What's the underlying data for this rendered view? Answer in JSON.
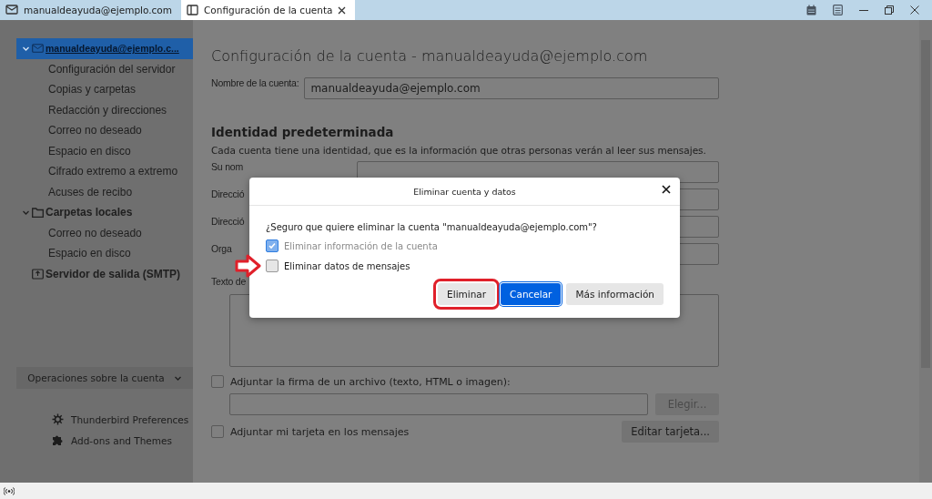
{
  "tabs": [
    {
      "label": "manualdeayuda@ejemplo.com",
      "kind": "mail",
      "selected": false
    },
    {
      "label": "Configuración de la cuenta",
      "kind": "settings",
      "selected": true,
      "closable": true
    }
  ],
  "sidebar": {
    "tree": [
      {
        "label": "manualdeayuda@ejemplo.c...",
        "kind": "account",
        "expanded": true,
        "selected": true,
        "children": [
          {
            "label": "Configuración del servidor"
          },
          {
            "label": "Copias y carpetas"
          },
          {
            "label": "Redacción y direcciones"
          },
          {
            "label": "Correo no deseado"
          },
          {
            "label": "Espacio en disco"
          },
          {
            "label": "Cifrado extremo a extremo"
          },
          {
            "label": "Acuses de recibo"
          }
        ]
      },
      {
        "label": "Carpetas locales",
        "kind": "folder",
        "expanded": true,
        "selected": false,
        "children": [
          {
            "label": "Correo no deseado"
          },
          {
            "label": "Espacio en disco"
          }
        ]
      },
      {
        "label": "Servidor de salida (SMTP)",
        "kind": "server",
        "selected": false
      }
    ],
    "operations_button": "Operaciones sobre la cuenta",
    "footer_links": [
      {
        "label": "Thunderbird Preferences",
        "kind": "settings"
      },
      {
        "label": "Add-ons and Themes",
        "kind": "addons"
      }
    ]
  },
  "content": {
    "title": "Configuración de la cuenta - manualdeayuda@ejemplo.com",
    "account_name": {
      "label": "Nombre de la cuenta:",
      "value": "manualdeayuda@ejemplo.com"
    },
    "section_heading": "Identidad predeterminada",
    "description": "Cada cuenta tiene una identidad, que es la información que otras personas verán al leer sus mensajes.",
    "fields": [
      {
        "label": "Su nom"
      },
      {
        "label": "Direcció"
      },
      {
        "label": "Direcció"
      },
      {
        "label": "Orga"
      }
    ],
    "signature_label": "Texto de",
    "attach_signature": {
      "label": "Adjuntar la firma de un archivo (texto, HTML o imagen):",
      "checked": false
    },
    "choose_button": {
      "label": "Elegir...",
      "disabled": true
    },
    "attach_card": {
      "label": "Adjuntar mi tarjeta en los mensajes",
      "checked": false
    },
    "edit_card_button": "Editar tarjeta..."
  },
  "dialog": {
    "title": "Eliminar cuenta y datos",
    "question": "¿Seguro que quiere eliminar la cuenta \"manualdeayuda@ejemplo.com\"?",
    "checkboxes": [
      {
        "label": "Eliminar información de la cuenta",
        "checked": true,
        "disabled": true,
        "pointed": false
      },
      {
        "label": "Eliminar datos de mensajes",
        "checked": false,
        "disabled": false,
        "pointed": true
      }
    ],
    "buttons": [
      {
        "label": "Eliminar",
        "kind": "plain",
        "highlighted": true
      },
      {
        "label": "Cancelar",
        "kind": "primary",
        "highlighted": false
      },
      {
        "label": "Más información",
        "kind": "plain",
        "highlighted": false
      }
    ]
  }
}
